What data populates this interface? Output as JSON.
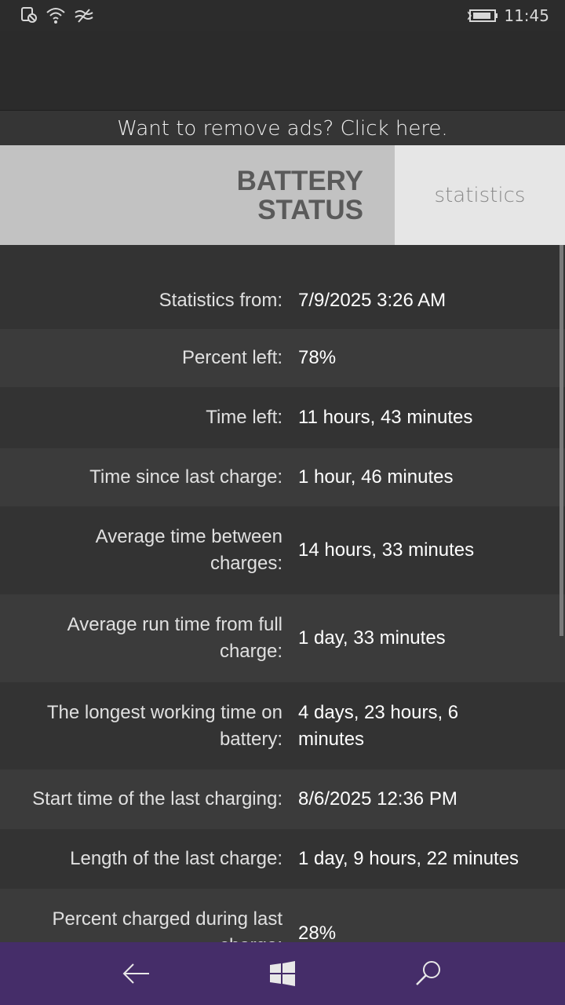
{
  "status_bar": {
    "time": "11:45",
    "icons": [
      "notification-icon",
      "wifi-icon",
      "data-sense-icon",
      "battery-charging-icon"
    ]
  },
  "remove_ads": "Want to remove ads? Click here.",
  "header": {
    "title": "BATTERY\nSTATUS",
    "tab": "statistics"
  },
  "stats": [
    {
      "label": "Statistics from:",
      "value": "7/9/2025 3:26 AM"
    },
    {
      "label": "Percent left:",
      "value": "78%"
    },
    {
      "label": "Time left:",
      "value": "11 hours, 43 minutes"
    },
    {
      "label": "Time since last charge:",
      "value": "1 hour, 46 minutes"
    },
    {
      "label": "Average time between charges:",
      "value": "14 hours, 33 minutes"
    },
    {
      "label": "Average run time from full charge:",
      "value": "1 day, 33 minutes"
    },
    {
      "label": "The longest working time on battery:",
      "value": "4 days, 23 hours, 6 minutes"
    },
    {
      "label": "Start time of the last charging:",
      "value": "8/6/2025 12:36 PM"
    },
    {
      "label": "Length of the last charge:",
      "value": "1 day, 9 hours, 22 minutes"
    },
    {
      "label": "Percent charged during last charge:",
      "value": "28%"
    }
  ],
  "nav": [
    "back-icon",
    "windows-icon",
    "search-icon"
  ],
  "colors": {
    "nav_bar": "#452d69",
    "header_title_bg": "#c2c2c2",
    "header_tab_bg": "#e6e6e6"
  }
}
